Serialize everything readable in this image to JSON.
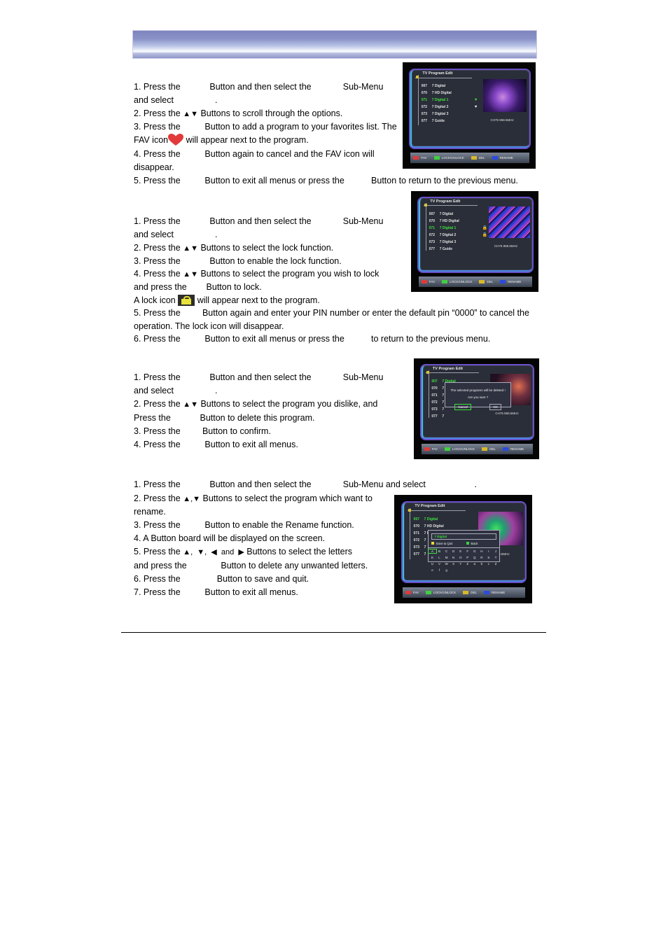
{
  "sections": [
    {
      "lines": [
        "1. Press the            Button and then select the             Sub-Menu",
        "and select                 .",
        {
          "pre": "2. Press the ",
          "arrows": "▲▼",
          "post": " Buttons to scroll through the options."
        },
        "3. Press the          Button to add a program to your favorites list. The",
        {
          "pre": "FAV icon",
          "icon": "heart",
          "post": " will appear next to the program."
        },
        "4. Press the          Button again to cancel and the FAV icon will",
        "disappear.",
        "5. Press the          Button to exit all menus or press the           Button to return to the previous menu."
      ]
    },
    {
      "lines": [
        "1. Press the            Button and then select the             Sub-Menu",
        "and select                 .",
        {
          "pre": "2. Press the ",
          "arrows": "▲▼",
          "post": " Buttons to select the lock function."
        },
        "3. Press the            Button to enable the lock function.",
        {
          "pre": "4. Press the ",
          "arrows": "▲▼",
          "post": " Buttons to select the program you wish to lock"
        },
        "and press the        Button to lock.",
        {
          "pre": "A lock icon ",
          "icon": "lock",
          "post": " will appear next to the program."
        },
        "5. Press the         Button again and enter your PIN number or enter the default pin “0000” to cancel the",
        "operation. The lock icon will disappear.",
        "6. Press the          Button to exit all menus or press the           to return to the previous menu."
      ]
    },
    {
      "lines": [
        "1. Press the            Button and then select the             Sub-Menu",
        "and select                 .",
        {
          "pre": "2. Press the ",
          "arrows": "▲▼",
          "post": " Buttons to select the program you dislike, and"
        },
        "Press the            Button to delete this program.",
        "3. Press the         Button to confirm.",
        "4. Press the          Button to exit all menus."
      ]
    },
    {
      "lines": [
        "1. Press the            Button and then select the             Sub-Menu and select                    .",
        {
          "pre": "2. Press the ",
          "arrows": "▲,▼",
          "post": " Buttons to select the program which want to"
        },
        "rename.",
        "3. Press the          Button to enable the Rename function.",
        "4. A Button board will be displayed on the screen.",
        {
          "pre": "5. Press the ",
          "arrows": "▲,  ▼,  ◀  and  ▶",
          "post": " Buttons to select the letters"
        },
        "and press the              Button to delete any unwanted letters.",
        "6. Press the               Button to save and quit.",
        "7. Press the          Button to exit all menus."
      ]
    }
  ],
  "tv": {
    "title": "TV Program Edit",
    "freq": "CH75   858.5MHz",
    "keys": [
      {
        "label": "FAV",
        "color": "#e03a3a"
      },
      {
        "label": "LOCK/UNLOCK",
        "color": "#3fd03f"
      },
      {
        "label": "DEL",
        "color": "#d8b82a"
      },
      {
        "label": "RENAME",
        "color": "#2a4ae0"
      }
    ],
    "fav_rows": [
      {
        "num": "007",
        "name": "7 Digital"
      },
      {
        "num": "070",
        "name": "7 HD Digital"
      },
      {
        "num": "071",
        "name": "7 Digital 1",
        "selected": true,
        "mark": "♥"
      },
      {
        "num": "072",
        "name": "7 Digital 2",
        "mark": "♥"
      },
      {
        "num": "073",
        "name": "7 Digital 3"
      },
      {
        "num": "077",
        "name": "7 Guide"
      }
    ],
    "lock_rows": [
      {
        "num": "007",
        "name": "7 Digital"
      },
      {
        "num": "070",
        "name": "7 HD Digital"
      },
      {
        "num": "071",
        "name": "7 Digital 1",
        "selected": true,
        "mark": "🔒"
      },
      {
        "num": "072",
        "name": "7 Digital 2",
        "mark": "🔒"
      },
      {
        "num": "073",
        "name": "7 Digital 3"
      },
      {
        "num": "077",
        "name": "7 Guide"
      }
    ],
    "del_rows": [
      {
        "num": "007",
        "name": "7 Digital",
        "selected": true
      },
      {
        "num": "070",
        "name": "7"
      },
      {
        "num": "071",
        "name": "7"
      },
      {
        "num": "072",
        "name": "7"
      },
      {
        "num": "073",
        "name": "7"
      },
      {
        "num": "077",
        "name": "7"
      }
    ],
    "rename_rows": [
      {
        "num": "007",
        "name": "7 Digital",
        "selected": true
      },
      {
        "num": "070",
        "name": "7 HD Digital"
      },
      {
        "num": "071",
        "name": "7 Digital 1"
      },
      {
        "num": "072",
        "name": "7"
      },
      {
        "num": "073",
        "name": "7"
      },
      {
        "num": "077",
        "name": "7"
      }
    ],
    "dialog": {
      "message": "The selected programs will be deleted !",
      "question": "Are you sure ?",
      "cancel": "Cancel",
      "ok": "OK"
    },
    "keyboard": {
      "field": "7 Digital",
      "save_quit": "Save & Quit",
      "back": "Back",
      "letters": [
        "A",
        "B",
        "C",
        "D",
        "E",
        "F",
        "G",
        "H",
        "I",
        "J",
        "K",
        "L",
        "M",
        "N",
        "O",
        "P",
        "Q",
        "R",
        "S",
        "T",
        "U",
        "V",
        "W",
        "X",
        "Y",
        "Z",
        "a",
        "b",
        "c",
        "d",
        "e",
        "f",
        "g"
      ],
      "selected": "A"
    }
  }
}
